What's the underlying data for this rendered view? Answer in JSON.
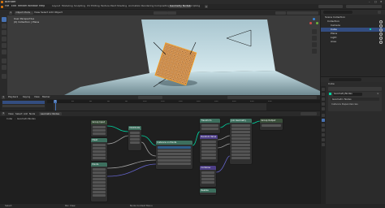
{
  "window": {
    "title": "Blender"
  },
  "menu": [
    "File",
    "Edit",
    "Render",
    "Window",
    "Help"
  ],
  "workspaces": [
    "Layout",
    "Modeling",
    "Sculpting",
    "UV Editing",
    "Texture Paint",
    "Shading",
    "Animation",
    "Rendering",
    "Compositing",
    "Geometry Nodes",
    "Scripting"
  ],
  "active_workspace": "Geometry Nodes",
  "viewport": {
    "mode": "Object Mode",
    "menus": [
      "View",
      "Select",
      "Add",
      "Object"
    ],
    "overlay_line1": "User Perspective",
    "overlay_line2": "(0) Collection | Plane"
  },
  "outliner": {
    "items": [
      {
        "label": "Collection",
        "selected": false
      },
      {
        "label": "Camera",
        "selected": false
      },
      {
        "label": "Cube",
        "selected": true
      },
      {
        "label": "Plane",
        "selected": false
      },
      {
        "label": "Light",
        "selected": false
      },
      {
        "label": "Area",
        "selected": false
      }
    ]
  },
  "properties": {
    "section": "GeometryNodes",
    "modifier_name": "GeometryNodes",
    "rows": [
      "Geometry Nodes",
      "Instance Dependencies"
    ]
  },
  "timeline": {
    "menus": [
      "Playback",
      "Keying",
      "View",
      "Marker"
    ],
    "ticks": [
      "0",
      "20",
      "40",
      "60",
      "80",
      "100",
      "120",
      "140",
      "160",
      "180",
      "200",
      "220",
      "240"
    ],
    "frame_label": "1"
  },
  "node_editor": {
    "menus": [
      "View",
      "Select",
      "Add",
      "Node"
    ],
    "tree_name": "Geometry Nodes",
    "breadcrumb": [
      "Cube",
      "GeometryNodes"
    ],
    "nodes": [
      {
        "id": "n1",
        "title": "Group Input",
        "color": "#3a4f3a"
      },
      {
        "id": "n2",
        "title": "Mesh",
        "color": "#3d6f5e"
      },
      {
        "id": "n3",
        "title": "Points",
        "color": "#3d6f5e"
      },
      {
        "id": "n4",
        "title": "Distribute",
        "color": "#3d6f5e"
      },
      {
        "id": "n5",
        "title": "Instance on Points",
        "color": "#3d6f5e"
      },
      {
        "id": "n6",
        "title": "Transform",
        "color": "#3d6f5e"
      },
      {
        "id": "n7",
        "title": "Random Value",
        "color": "#4d3e86"
      },
      {
        "id": "n8",
        "title": "Combine",
        "color": "#4d3e86"
      },
      {
        "id": "n9",
        "title": "Realize",
        "color": "#3d6f5e"
      },
      {
        "id": "n10",
        "title": "Join Geometry",
        "color": "#3d6f5e"
      },
      {
        "id": "n11",
        "title": "Group Output",
        "color": "#3a4f3a"
      }
    ]
  },
  "colors": {
    "accent": "#4772b3",
    "orange": "#e87d0d",
    "geometry_socket": "#00d6a3",
    "float_socket": "#a1a1a1",
    "vector_socket": "#6363c7"
  },
  "statusbar": {
    "left": "Select",
    "mid": "Pan View",
    "right": "Node Context Menu"
  }
}
